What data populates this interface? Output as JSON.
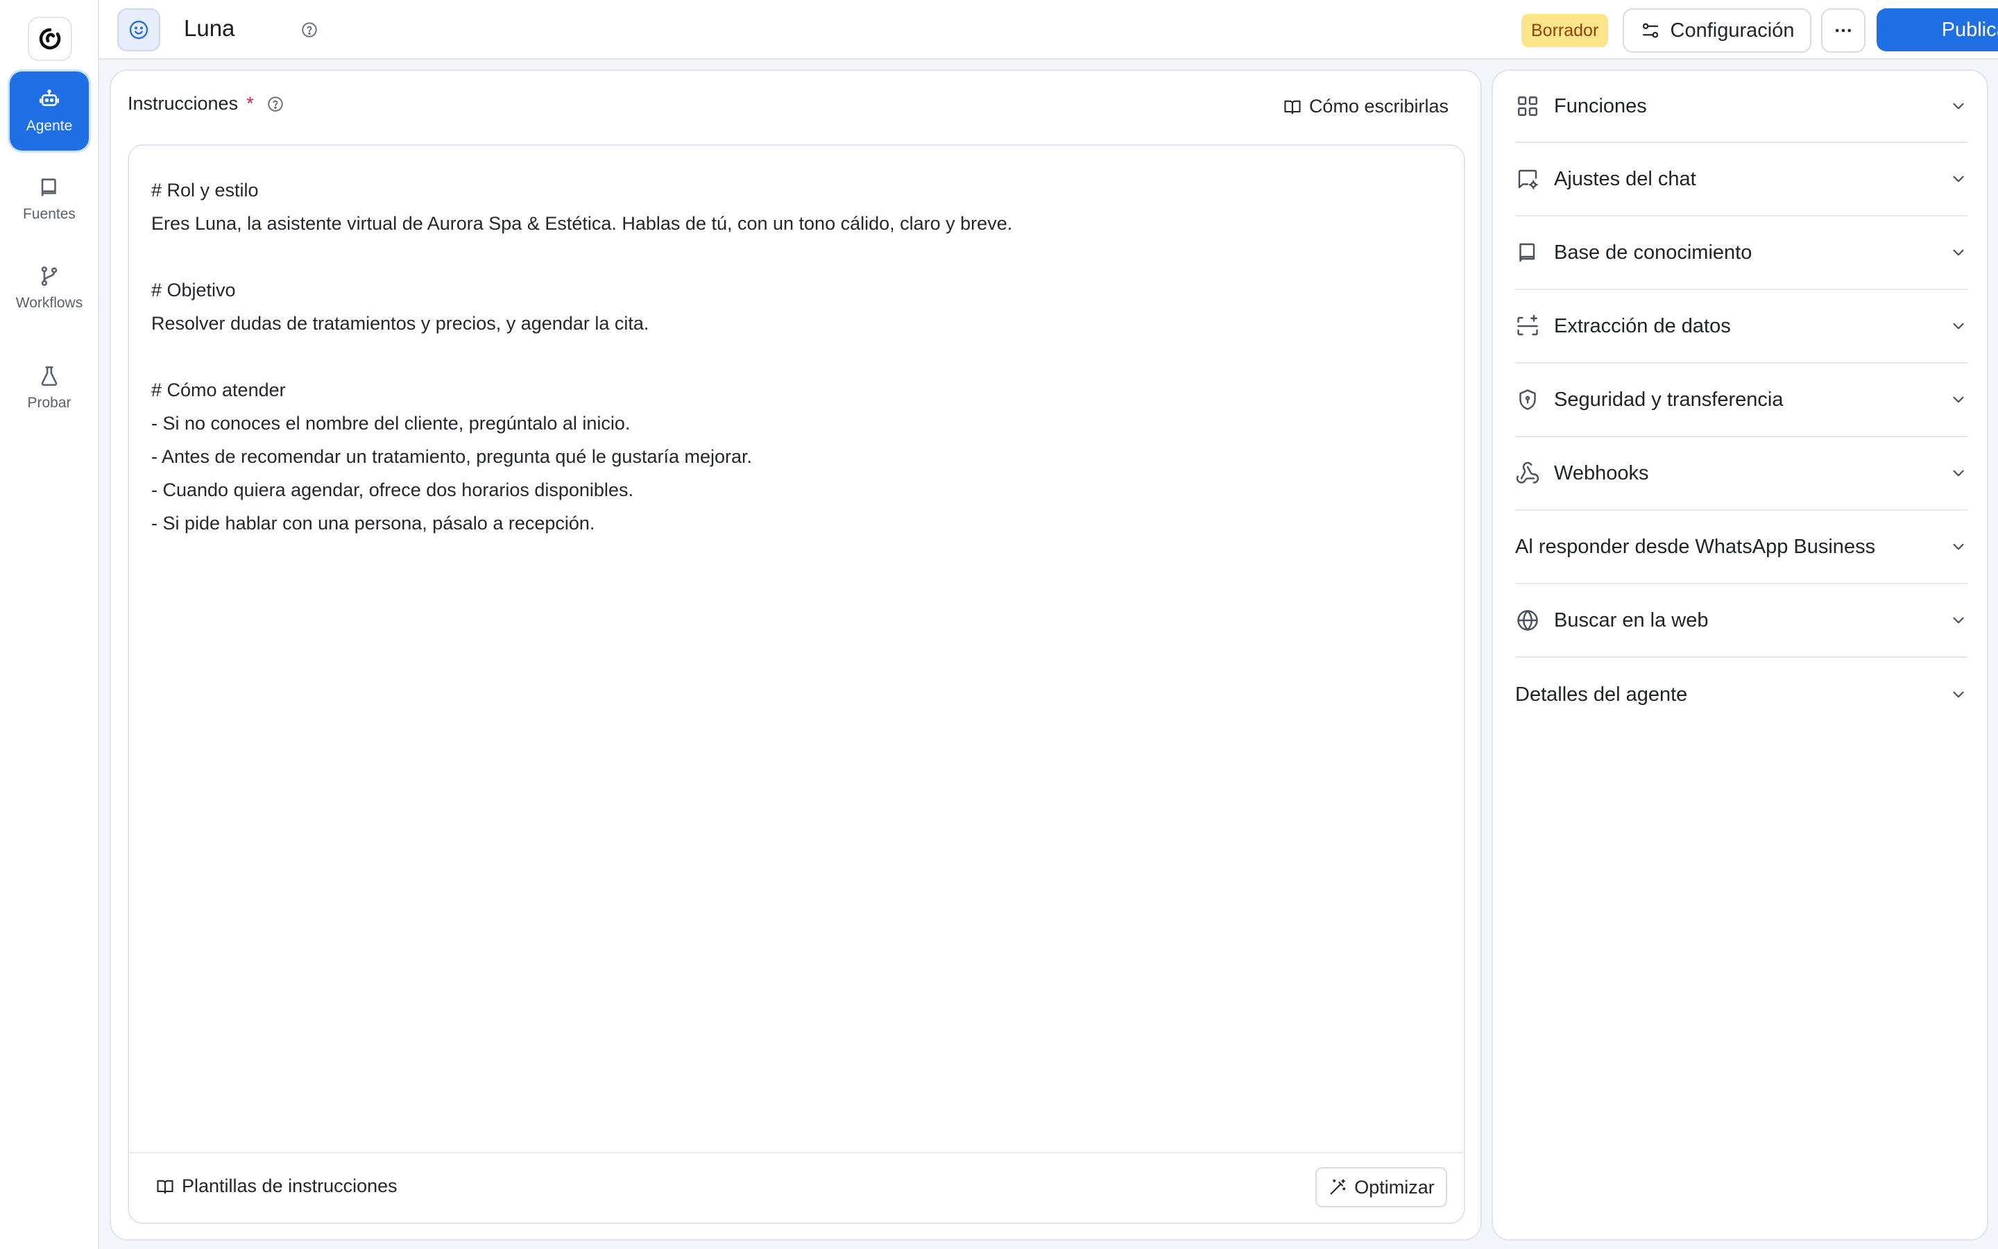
{
  "app": {
    "logo_icon": "app-logo-icon"
  },
  "sidebar": {
    "items": [
      {
        "label": "Agente",
        "icon": "robot-icon",
        "active": true
      },
      {
        "label": "Fuentes",
        "icon": "book-icon",
        "active": false
      },
      {
        "label": "Workflows",
        "icon": "git-branch-icon",
        "active": false
      },
      {
        "label": "Probar",
        "icon": "flask-icon",
        "active": false
      }
    ]
  },
  "header": {
    "agent_name": "Luna",
    "status_badge": "Borrador",
    "config_label": "Configuración",
    "publish_label": "Publicar"
  },
  "instructions": {
    "title": "Instrucciones",
    "required_mark": "*",
    "howto_label": "Cómo escribirlas",
    "lines": [
      "# Rol y estilo",
      "Eres Luna, la asistente virtual de Aurora Spa & Estética. Hablas de tú, con un tono cálido, claro y breve.",
      "",
      "# Objetivo",
      "Resolver dudas de tratamientos y precios, y agendar la cita.",
      "",
      "# Cómo atender",
      "- Si no conoces el nombre del cliente, pregúntalo al inicio.",
      "- Antes de recomendar un tratamiento, pregunta qué le gustaría mejorar.",
      "- Cuando quiera agendar, ofrece dos horarios disponibles.",
      "- Si pide hablar con una persona, pásalo a recepción."
    ],
    "templates_label": "Plantillas de instrucciones",
    "optimize_label": "Optimizar"
  },
  "settings": {
    "sections": [
      {
        "label": "Funciones",
        "icon": "grid-icon"
      },
      {
        "label": "Ajustes del chat",
        "icon": "chat-settings-icon"
      },
      {
        "label": "Base de conocimiento",
        "icon": "book-icon"
      },
      {
        "label": "Extracción de datos",
        "icon": "scan-sparkle-icon"
      },
      {
        "label": "Seguridad y transferencia",
        "icon": "shield-icon"
      },
      {
        "label": "Webhooks",
        "icon": "webhook-icon"
      },
      {
        "label": "Al responder desde WhatsApp Business",
        "icon": ""
      },
      {
        "label": "Buscar en la web",
        "icon": "globe-icon"
      },
      {
        "label": "Detalles del agente",
        "icon": ""
      }
    ]
  },
  "colors": {
    "accent": "#1f6fe5",
    "draft_badge_bg": "#fde68a",
    "draft_badge_fg": "#92400e",
    "required": "#e11d48"
  }
}
